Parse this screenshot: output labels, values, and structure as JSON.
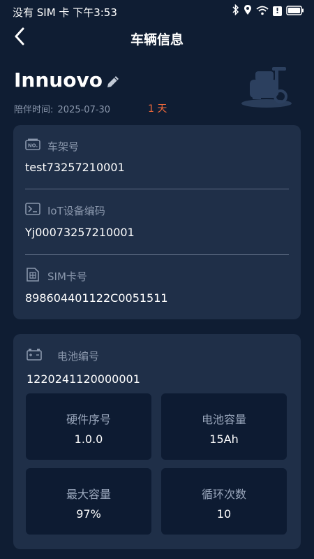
{
  "status_bar": {
    "left_text": "没有 SIM 卡 下午3:53",
    "battery_text": "!"
  },
  "nav": {
    "title": "车辆信息",
    "back_icon": "chevron-left-icon"
  },
  "vehicle": {
    "name": "Innuovo",
    "companion_label": "陪伴时间:",
    "companion_date": "2025-07-30",
    "days": "1 天"
  },
  "info_card": {
    "fields": [
      {
        "label": "车架号",
        "value": "test73257210001",
        "icon": "frame-number-icon"
      },
      {
        "label": "IoT设备编码",
        "value": "Yj00073257210001",
        "icon": "terminal-icon"
      },
      {
        "label": "SIM卡号",
        "value": "898604401122C0051511",
        "icon": "sim-card-icon"
      }
    ]
  },
  "battery_card": {
    "label": "电池编号",
    "value": "1220241120000001",
    "tiles": [
      {
        "label": "硬件序号",
        "value": "1.0.0"
      },
      {
        "label": "电池容量",
        "value": "15Ah"
      },
      {
        "label": "最大容量",
        "value": "97%"
      },
      {
        "label": "循环次数",
        "value": "10"
      }
    ]
  },
  "colors": {
    "background": "#0f1d33",
    "card": "#1f2f48",
    "tile": "#0d1b32",
    "accent_days": "#f26a3b"
  }
}
